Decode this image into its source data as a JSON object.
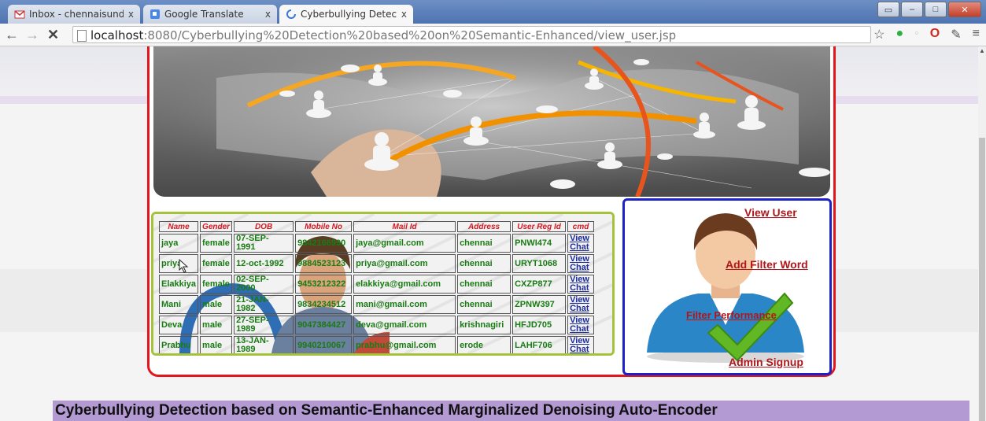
{
  "browser": {
    "tabs": [
      {
        "label": "Inbox - chennaisunday.co",
        "icon": "gmail-icon"
      },
      {
        "label": "Google Translate",
        "icon": "translate-icon"
      },
      {
        "label": "Cyberbullying Detection",
        "icon": "loading-icon"
      }
    ],
    "url_host": "localhost",
    "url_rest": ":8080/Cyberbullying%20Detection%20based%20on%20Semantic-Enhanced/view_user.jsp",
    "close_symbol": "x"
  },
  "table": {
    "headers": [
      "Name",
      "Gender",
      "DOB",
      "Mobile No",
      "Mail Id",
      "Address",
      "User Reg Id",
      "cmd"
    ],
    "rows": [
      {
        "name": "jaya",
        "gender": "female",
        "dob": "07-SEP-\n1991",
        "mobile": "9842166990",
        "mail": "jaya@gmail.com",
        "address": "chennai",
        "regid": "PNWI474",
        "cmd1": "View",
        "cmd2": "Chat"
      },
      {
        "name": "priya",
        "gender": "female",
        "dob": "12-oct-1992",
        "mobile": "9884523123",
        "mail": "priya@gmail.com",
        "address": "chennai",
        "regid": "URYT1068",
        "cmd1": "View",
        "cmd2": "Chat"
      },
      {
        "name": "Elakkiya",
        "gender": "female",
        "dob": "02-SEP-\n2000",
        "mobile": "9453212322",
        "mail": "elakkiya@gmail.com",
        "address": "chennai",
        "regid": "CXZP877",
        "cmd1": "View",
        "cmd2": "Chat"
      },
      {
        "name": "Mani",
        "gender": "male",
        "dob": "21-JAN-\n1982",
        "mobile": "9834234512",
        "mail": "mani@gmail.com",
        "address": "chennai",
        "regid": "ZPNW397",
        "cmd1": "View",
        "cmd2": "Chat"
      },
      {
        "name": "Deva",
        "gender": "male",
        "dob": "27-SEP-\n1989",
        "mobile": "9047384427",
        "mail": "deva@gmail.com",
        "address": "krishnagiri",
        "regid": "HFJD705",
        "cmd1": "View",
        "cmd2": "Chat"
      },
      {
        "name": "Prabhu",
        "gender": "male",
        "dob": "13-JAN-\n1989",
        "mobile": "9940210067",
        "mail": "prabhu@gmail.com",
        "address": "erode",
        "regid": "LAHF706",
        "cmd1": "View",
        "cmd2": "Chat"
      }
    ]
  },
  "admin_menu": {
    "view_user": "View User",
    "add_filter_word": "Add Filter Word",
    "filter_performance": "Filter Performance",
    "admin_signup": "Admin Signup"
  },
  "footer": {
    "title": "Cyberbullying Detection based on Semantic-Enhanced Marginalized Denoising Auto-Encoder"
  },
  "colors": {
    "frame": "#e3161b",
    "table_border": "#a6c13a",
    "admin_border": "#1a22c8",
    "footer_bg": "#b39ad3",
    "link": "#b0161a"
  }
}
